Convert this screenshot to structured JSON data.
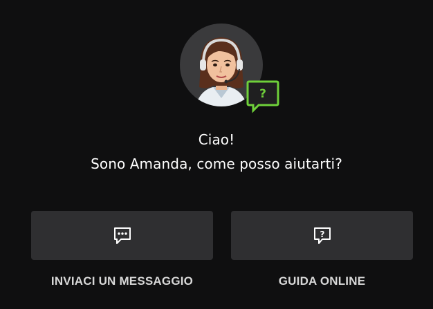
{
  "assistant": {
    "greeting_line1": "Ciao!",
    "greeting_line2": "Sono Amanda, come posso aiutarti?",
    "badge_symbol": "?"
  },
  "actions": [
    {
      "icon": "chat-bubble-dots-icon",
      "label": "INVIACI UN MESSAGGIO"
    },
    {
      "icon": "help-bubble-icon",
      "label": "GUIDA ONLINE",
      "symbol": "?"
    }
  ],
  "colors": {
    "background": "#0f0f10",
    "card": "#2f2f31",
    "accent_green": "#6fd13a",
    "text": "#ffffff",
    "label_text": "#d8d8d8"
  }
}
